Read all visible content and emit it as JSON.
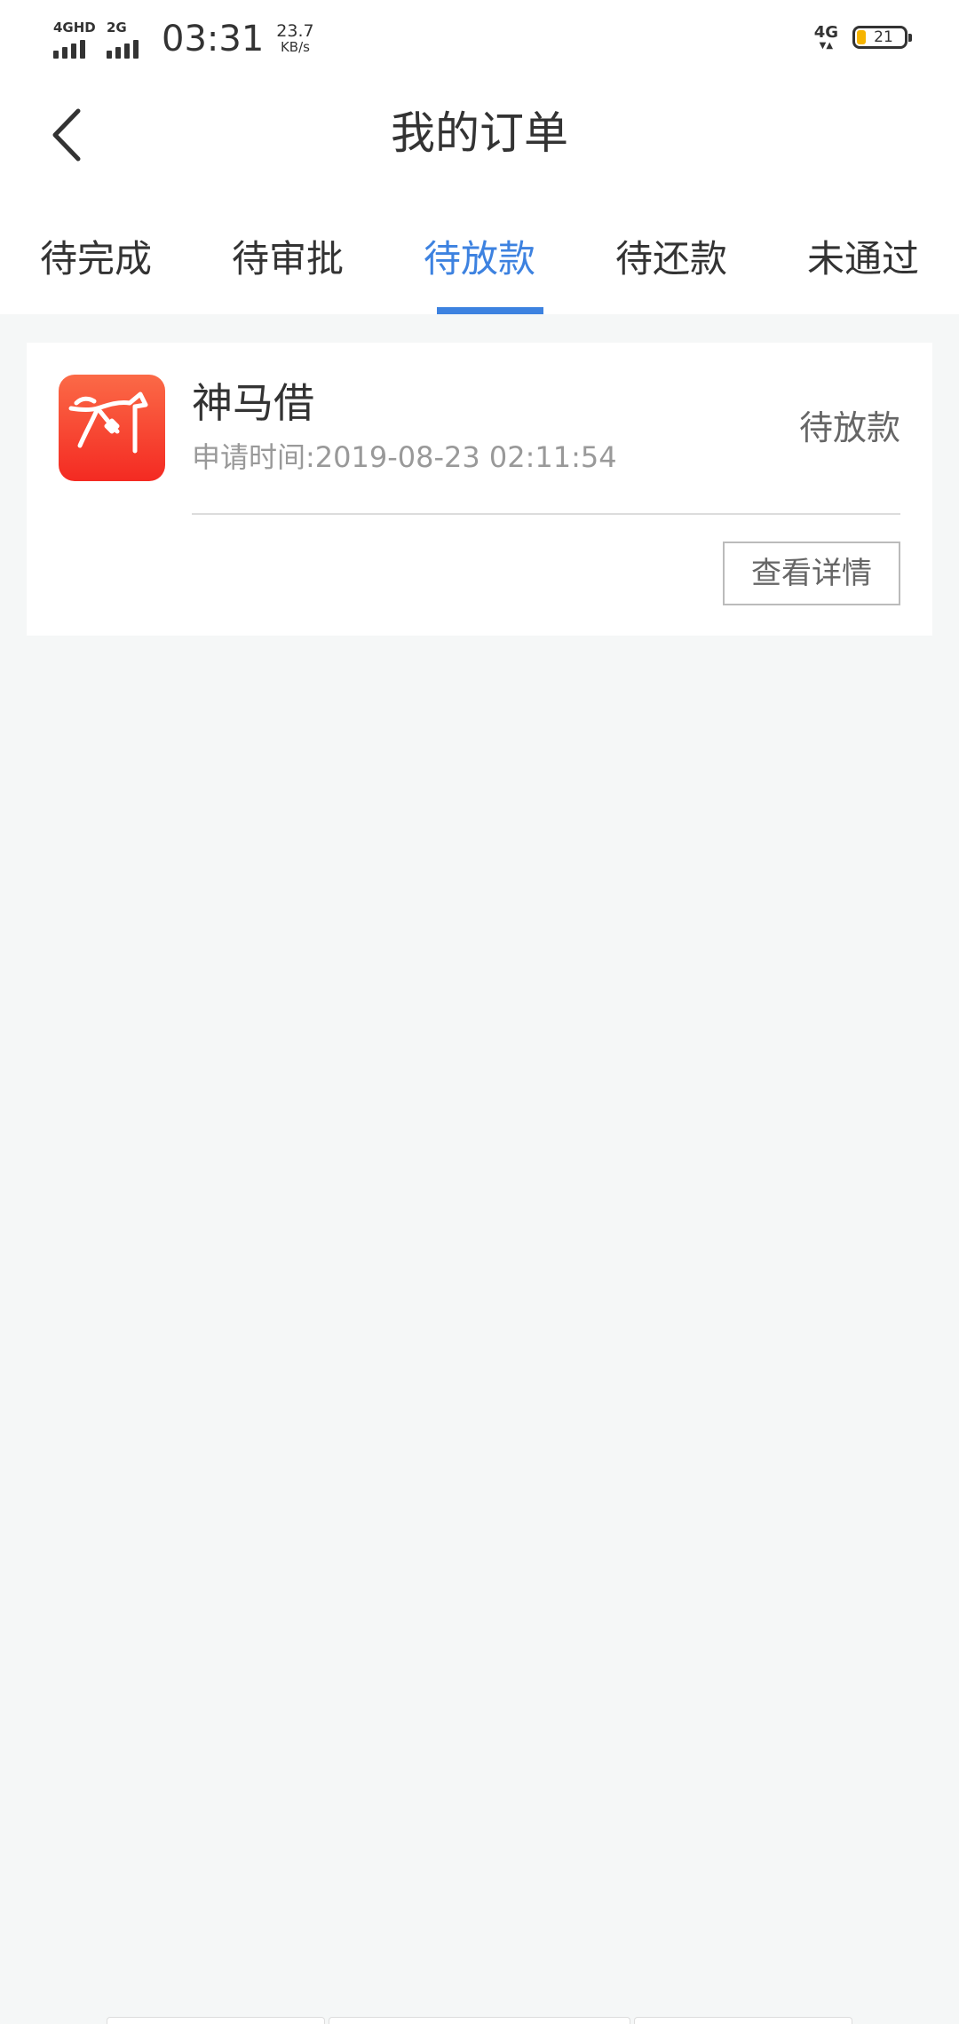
{
  "status_bar": {
    "sim1_label": "4GHD",
    "sim2_label": "2G",
    "time": "03:31",
    "speed_value": "23.7",
    "speed_unit": "KB/s",
    "network_type": "4G",
    "battery_level": "21",
    "battery_color": "#f6b400"
  },
  "header": {
    "back_icon": "chevron-left-icon",
    "title": "我的订单"
  },
  "tabs": [
    {
      "label": "待完成",
      "active": false
    },
    {
      "label": "待审批",
      "active": false
    },
    {
      "label": "待放款",
      "active": true
    },
    {
      "label": "待还款",
      "active": false
    },
    {
      "label": "未通过",
      "active": false
    }
  ],
  "accent_color": "#3d82e0",
  "orders": [
    {
      "app_name": "神马借",
      "logo_icon": "horse-logo-icon",
      "apply_time": "申请时间:2019-08-23 02:11:54",
      "status": "待放款",
      "detail_button_label": "查看详情"
    }
  ]
}
